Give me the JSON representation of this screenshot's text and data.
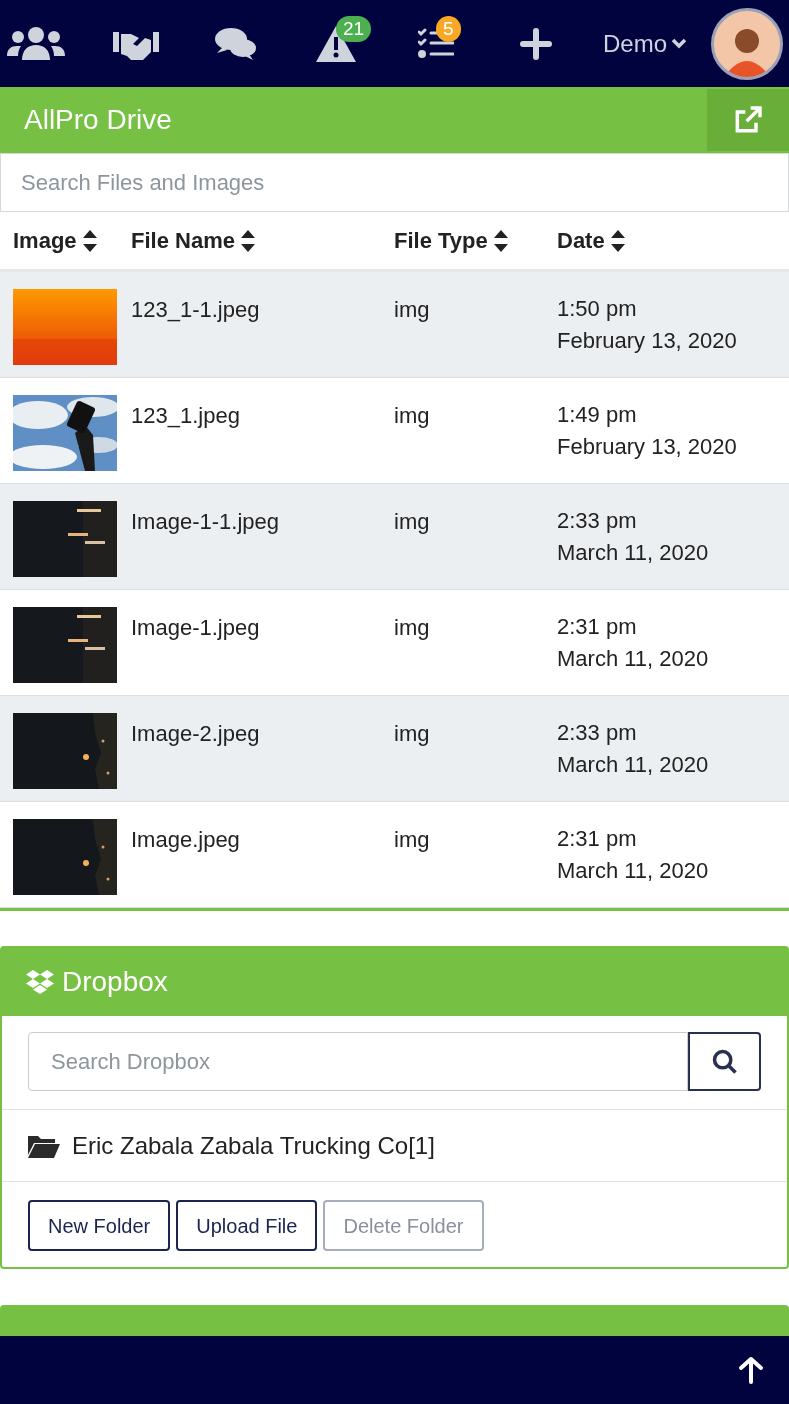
{
  "nav": {
    "icons": [
      {
        "kind": "users"
      },
      {
        "kind": "handshake"
      },
      {
        "kind": "chat"
      },
      {
        "kind": "alert",
        "badge": "21",
        "color": "#4caf50"
      },
      {
        "kind": "tasks",
        "badge": "5",
        "color": "#f9a825"
      },
      {
        "kind": "plus"
      }
    ],
    "user_menu": "Demo"
  },
  "drive": {
    "title": "AllPro Drive",
    "search": {
      "placeholder": "Search Files and Images"
    },
    "columns": [
      "Image",
      "File Name",
      "File Type",
      "Date"
    ],
    "rows": [
      {
        "file_name": "123_1-1.jpeg",
        "file_type": "img",
        "time": "1:50 pm",
        "date": "February 13, 2020"
      },
      {
        "file_name": "123_1.jpeg",
        "file_type": "img",
        "time": "1:49 pm",
        "date": "February 13, 2020"
      },
      {
        "file_name": "Image-1-1.jpeg",
        "file_type": "img",
        "time": "2:33 pm",
        "date": "March 11, 2020"
      },
      {
        "file_name": "Image-1.jpeg",
        "file_type": "img",
        "time": "2:31 pm",
        "date": "March 11, 2020"
      },
      {
        "file_name": "Image-2.jpeg",
        "file_type": "img",
        "time": "2:33 pm",
        "date": "March 11, 2020"
      },
      {
        "file_name": "Image.jpeg",
        "file_type": "img",
        "time": "2:31 pm",
        "date": "March 11, 2020"
      }
    ]
  },
  "dropbox": {
    "title": "Dropbox",
    "search": {
      "placeholder": "Search Dropbox"
    },
    "folder": "Eric Zabala Zabala Trucking Co[1]",
    "buttons": [
      {
        "label": "New Folder",
        "disabled": false
      },
      {
        "label": "Upload File",
        "disabled": false
      },
      {
        "label": "Delete Folder",
        "disabled": true
      }
    ]
  }
}
